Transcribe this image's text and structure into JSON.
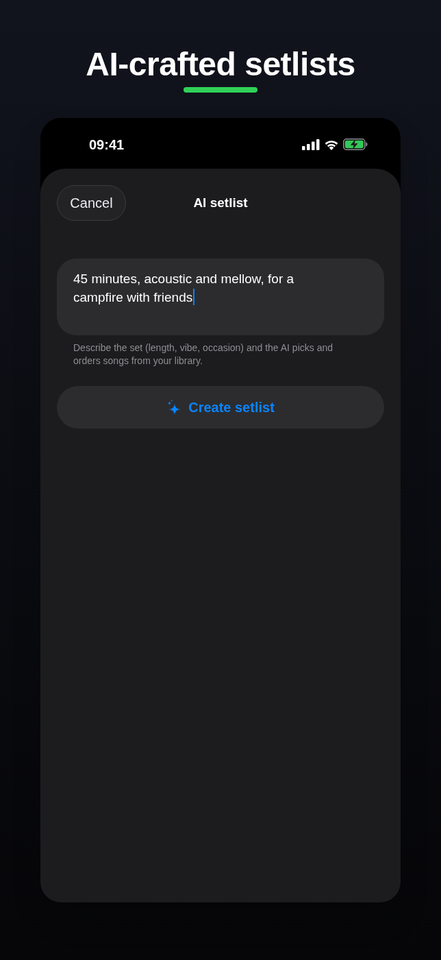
{
  "headline": {
    "title": "AI-crafted setlists"
  },
  "status_bar": {
    "time": "09:41"
  },
  "sheet": {
    "cancel_button": "Cancel",
    "title": "AI setlist"
  },
  "prompt_field": {
    "value": "45 minutes, acoustic and mellow, for a campfire with friends",
    "focused": true
  },
  "hint": "Describe the set (length, vibe, occasion) and the AI picks and orders songs from your library.",
  "create_button": {
    "label": "Create setlist"
  }
}
